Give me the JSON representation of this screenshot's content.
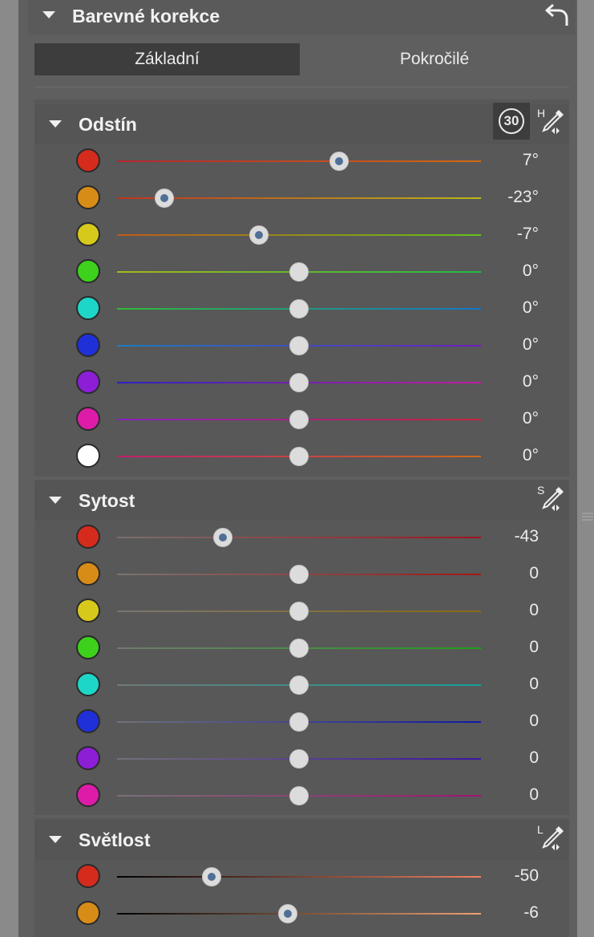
{
  "panel": {
    "title": "Barevné korekce",
    "tabs": [
      {
        "label": "Základní",
        "active": true
      },
      {
        "label": "Pokročilé",
        "active": false
      }
    ]
  },
  "hue": {
    "title": "Odstín",
    "badge": "30",
    "picker_letter": "H",
    "rows": [
      {
        "color": "#d42b1c",
        "value": "7°",
        "level": 0.61,
        "active": true,
        "track": [
          "#b8242e",
          "#d16a10"
        ]
      },
      {
        "color": "#d88c18",
        "value": "-23°",
        "level": 0.13,
        "active": true,
        "track": [
          "#c2331c",
          "#b8b818"
        ]
      },
      {
        "color": "#d6c91c",
        "value": "-7°",
        "level": 0.39,
        "active": true,
        "track": [
          "#c25a18",
          "#63c21a"
        ]
      },
      {
        "color": "#3dd11c",
        "value": "0°",
        "level": 0.5,
        "active": false,
        "track": [
          "#a6b81a",
          "#1fbc45"
        ]
      },
      {
        "color": "#1ed6c8",
        "value": "0°",
        "level": 0.5,
        "active": false,
        "track": [
          "#2ebc38",
          "#1577c8"
        ]
      },
      {
        "color": "#1f30d8",
        "value": "0°",
        "level": 0.5,
        "active": false,
        "track": [
          "#1a7cc0",
          "#6b1ec0"
        ]
      },
      {
        "color": "#8c1ed6",
        "value": "0°",
        "level": 0.5,
        "active": false,
        "track": [
          "#2c22c0",
          "#c01ea0"
        ]
      },
      {
        "color": "#dc1ca8",
        "value": "0°",
        "level": 0.5,
        "active": false,
        "track": [
          "#8a20c0",
          "#c4243a"
        ]
      },
      {
        "color": "#ffffff",
        "value": "0°",
        "level": 0.5,
        "active": false,
        "track": [
          "#c21e6e",
          "#cf6a18"
        ]
      }
    ]
  },
  "saturation": {
    "title": "Sytost",
    "picker_letter": "S",
    "rows": [
      {
        "color": "#d42b1c",
        "value": "-43",
        "level": 0.29,
        "active": true,
        "track": [
          "#7a7070",
          "#a0141c"
        ]
      },
      {
        "color": "#d88c18",
        "value": "0",
        "level": 0.5,
        "active": false,
        "track": [
          "#7a7470",
          "#a01818"
        ]
      },
      {
        "color": "#d6c91c",
        "value": "0",
        "level": 0.5,
        "active": false,
        "track": [
          "#7a7670",
          "#8a6a14"
        ]
      },
      {
        "color": "#3dd11c",
        "value": "0",
        "level": 0.5,
        "active": false,
        "track": [
          "#727a70",
          "#20a01c"
        ]
      },
      {
        "color": "#1ed6c8",
        "value": "0",
        "level": 0.5,
        "active": false,
        "track": [
          "#707a78",
          "#12a09a"
        ]
      },
      {
        "color": "#1f30d8",
        "value": "0",
        "level": 0.5,
        "active": false,
        "track": [
          "#70727a",
          "#1018a8"
        ]
      },
      {
        "color": "#8c1ed6",
        "value": "0",
        "level": 0.5,
        "active": false,
        "track": [
          "#74707a",
          "#3a14a0"
        ]
      },
      {
        "color": "#dc1ca8",
        "value": "0",
        "level": 0.5,
        "active": false,
        "track": [
          "#7a7078",
          "#a01470"
        ]
      }
    ]
  },
  "lightness": {
    "title": "Světlost",
    "picker_letter": "L",
    "rows": [
      {
        "color": "#d42b1c",
        "value": "-50",
        "level": 0.26,
        "active": true,
        "track": [
          "#000000",
          "#f08060"
        ]
      },
      {
        "color": "#d88c18",
        "value": "-6",
        "level": 0.47,
        "active": true,
        "track": [
          "#000000",
          "#f0a070"
        ]
      }
    ]
  }
}
